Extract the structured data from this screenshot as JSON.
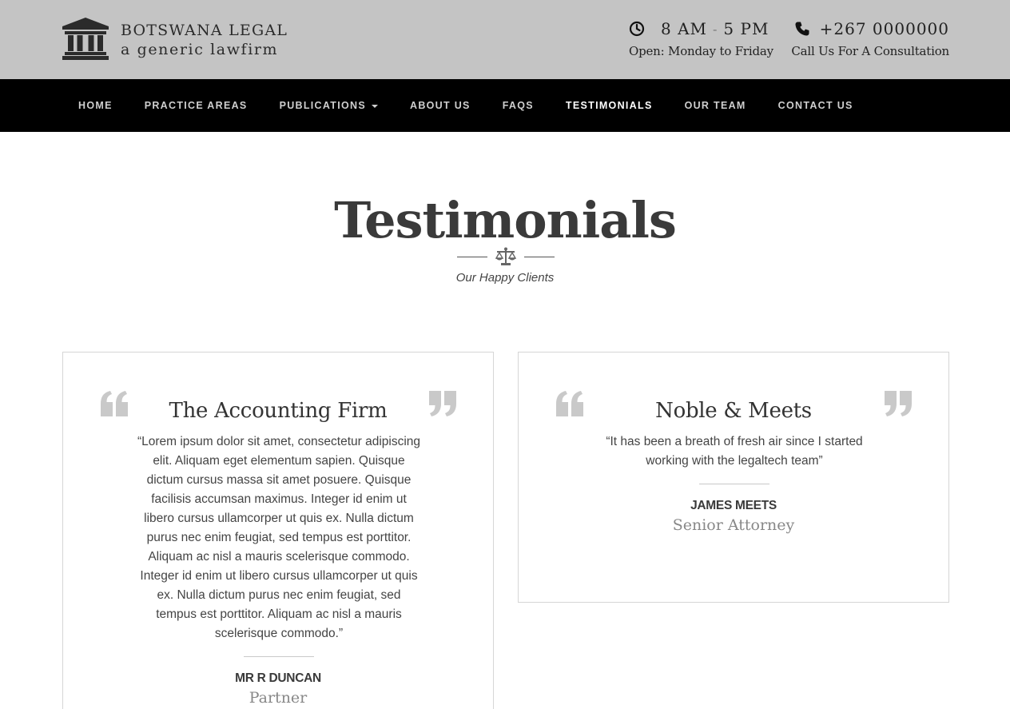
{
  "header": {
    "logo_line1": "BOTSWANA LEGAL",
    "logo_line2": "a generic lawfirm",
    "hours": {
      "main_start": "8 AM",
      "main_sep": "-",
      "main_end": "5 PM",
      "sub": "Open: Monday to Friday",
      "icon": "clock-icon"
    },
    "phone": {
      "main": "+267 0000000",
      "sub": "Call Us For A Consultation",
      "icon": "phone-icon"
    }
  },
  "nav": {
    "items": [
      {
        "label": "HOME"
      },
      {
        "label": "PRACTICE AREAS"
      },
      {
        "label": "PUBLICATIONS"
      },
      {
        "label": "ABOUT US"
      },
      {
        "label": "FAQS"
      },
      {
        "label": "TESTIMONIALS"
      },
      {
        "label": "OUR TEAM"
      },
      {
        "label": "CONTACT US"
      }
    ],
    "active": "TESTIMONIALS"
  },
  "section": {
    "title": "Testimonials",
    "subtitle": "Our Happy Clients",
    "divider_icon": "scales-icon"
  },
  "testimonials": [
    {
      "company": "The Accounting Firm",
      "quote": "“Lorem ipsum dolor sit amet, consectetur adipiscing elit. Aliquam eget elementum sapien. Quisque dictum cursus massa sit amet posuere. Quisque facilisis accumsan maximus. Integer id enim ut libero cursus ullamcorper ut quis ex. Nulla dictum purus nec enim feugiat, sed tempus est porttitor. Aliquam ac nisl a mauris scelerisque commodo. Integer id enim ut libero cursus ullamcorper ut quis ex. Nulla dictum purus nec enim feugiat, sed tempus est porttitor. Aliquam ac nisl a mauris scelerisque commodo.”",
      "name": "MR R DUNCAN",
      "role": "Partner"
    },
    {
      "company": "Noble & Meets",
      "quote": "“It has been a breath of fresh air since I started working with the legaltech team”",
      "name": "JAMES MEETS",
      "role": "Senior Attorney"
    }
  ],
  "colors": {
    "topbar": "#c4c4c4",
    "navbar": "#000000",
    "nav_text": "#cfcfcf",
    "nav_active": "#ffffff",
    "quote_marks": "#c9c9c9"
  }
}
